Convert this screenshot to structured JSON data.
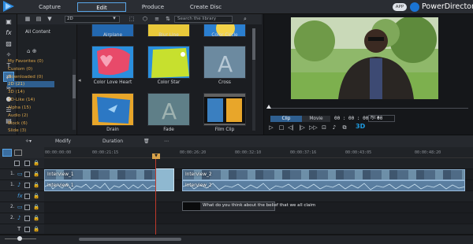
{
  "tabs": [
    {
      "label": "Capture"
    },
    {
      "label": "Edit",
      "active": true
    },
    {
      "label": "Produce"
    },
    {
      "label": "Create Disc"
    }
  ],
  "app_badge": "APP",
  "brand": "PowerDirector",
  "library": {
    "type_select": "2D",
    "search_placeholder": "Search the library"
  },
  "categories": {
    "header": "All Content",
    "items": [
      {
        "label": "My Favorites  (0)"
      },
      {
        "label": "Custom  (0)"
      },
      {
        "label": "Downloaded  (0)"
      },
      {
        "label": "2D  (21)",
        "selected": true
      },
      {
        "label": "3D  (14)"
      },
      {
        "label": "3D-Like  (14)"
      },
      {
        "label": "Alpha  (15)"
      },
      {
        "label": "Audio  (2)"
      },
      {
        "label": "Block  (6)"
      },
      {
        "label": "Slide  (3)"
      }
    ]
  },
  "thumbnails": [
    {
      "label": "Airplane"
    },
    {
      "label": "Blur Line"
    },
    {
      "label": "Color Circle"
    },
    {
      "label": "Color Love Heart"
    },
    {
      "label": "Color Star"
    },
    {
      "label": "Cross"
    },
    {
      "label": "Drain"
    },
    {
      "label": "Fade"
    },
    {
      "label": "Film Clip"
    }
  ],
  "preview": {
    "mode_clip": "Clip",
    "mode_movie": "Movie",
    "timecode": "00 : 00 : 00 : 00",
    "fit": "Fit",
    "badge_3d": "3D"
  },
  "timeline_toolbar": {
    "modify": "Modify",
    "duration": "Duration"
  },
  "ruler_ticks": [
    "00:00:00:00",
    "00:00:21:15",
    "00:00:26:20",
    "00:00:32:10",
    "00:00:37:16",
    "00:00:43:05",
    "00:00:48:20"
  ],
  "tracks": [
    {
      "num": "1.",
      "icon": "video-track-icon",
      "glyph": "▭"
    },
    {
      "num": "1.",
      "icon": "audio-track-icon",
      "glyph": "♪"
    },
    {
      "num": "",
      "icon": "fx-track-icon",
      "glyph": "fx"
    },
    {
      "num": "2.",
      "icon": "video-track-icon",
      "glyph": "▭"
    },
    {
      "num": "2.",
      "icon": "audio-track-icon",
      "glyph": "♪"
    },
    {
      "num": "",
      "icon": "title-track-icon",
      "glyph": "T"
    },
    {
      "num": "",
      "icon": "voice-track-icon",
      "glyph": "🎙"
    }
  ],
  "clips": {
    "video_a": "Interview_1",
    "video_b": "Interview_2",
    "audio_a": "Interview_1",
    "audio_b": "Interview_2",
    "subtitle": "What do you think about the belief that we all claim"
  },
  "colors": {
    "accent": "#5aa6e8",
    "category_text": "#d9a34a",
    "playhead": "#c0392b"
  }
}
